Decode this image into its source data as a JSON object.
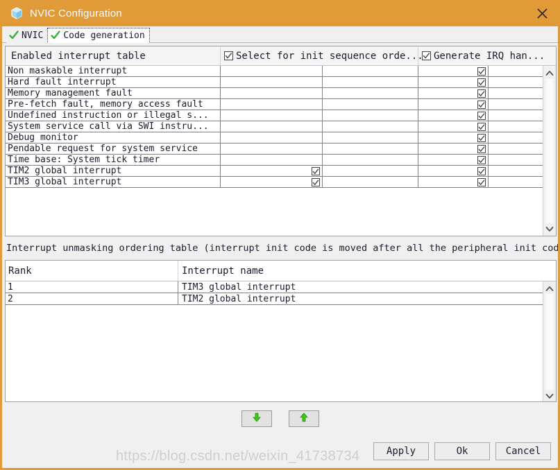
{
  "window": {
    "title": "NVIC Configuration",
    "icon": "cube-icon",
    "close_icon": "close-icon",
    "titlebar_color": "#e09a38",
    "border_color": "#e09a38"
  },
  "tabs": [
    {
      "label": "NVIC",
      "icon": "green-check-icon",
      "active": false
    },
    {
      "label": "Code generation",
      "icon": "green-check-icon",
      "active": true
    }
  ],
  "interrupt_table": {
    "columns": [
      {
        "key": "name",
        "label": "Enabled interrupt table",
        "checkbox": null
      },
      {
        "key": "init_seq",
        "label": "Select for init sequence orde...",
        "checkbox": true
      },
      {
        "key": "irq_handler",
        "label": "Generate IRQ han...",
        "checkbox": true
      }
    ],
    "rows": [
      {
        "name": "Non maskable interrupt",
        "init_seq": false,
        "irq_handler": true
      },
      {
        "name": "Hard fault interrupt",
        "init_seq": false,
        "irq_handler": true
      },
      {
        "name": "Memory management fault",
        "init_seq": false,
        "irq_handler": true
      },
      {
        "name": "Pre-fetch fault, memory access fault",
        "init_seq": false,
        "irq_handler": true
      },
      {
        "name": "Undefined instruction or illegal s...",
        "init_seq": false,
        "irq_handler": true
      },
      {
        "name": "System service call via SWI instru...",
        "init_seq": false,
        "irq_handler": true
      },
      {
        "name": "Debug monitor",
        "init_seq": false,
        "irq_handler": true
      },
      {
        "name": "Pendable request for system service",
        "init_seq": false,
        "irq_handler": true
      },
      {
        "name": "Time base: System tick timer",
        "init_seq": false,
        "irq_handler": true
      },
      {
        "name": "TIM2 global interrupt",
        "init_seq": true,
        "irq_handler": true
      },
      {
        "name": "TIM3 global interrupt",
        "init_seq": true,
        "irq_handler": true
      }
    ]
  },
  "ordering": {
    "label": "Interrupt unmasking ordering table (interrupt init code is moved after all the peripheral init code)",
    "columns": [
      "Rank",
      "Interrupt name"
    ],
    "rows": [
      {
        "rank": "1",
        "name": "TIM3 global interrupt"
      },
      {
        "rank": "2",
        "name": "TIM2 global interrupt"
      }
    ]
  },
  "move_buttons": [
    {
      "name": "move-down-button",
      "icon": "arrow-down-icon",
      "color": "#3ec715"
    },
    {
      "name": "move-up-button",
      "icon": "arrow-up-icon",
      "color": "#3ec715"
    }
  ],
  "actions": {
    "apply": "Apply",
    "ok": "Ok",
    "cancel": "Cancel"
  },
  "watermark": "https://blog.csdn.net/weixin_41738734"
}
